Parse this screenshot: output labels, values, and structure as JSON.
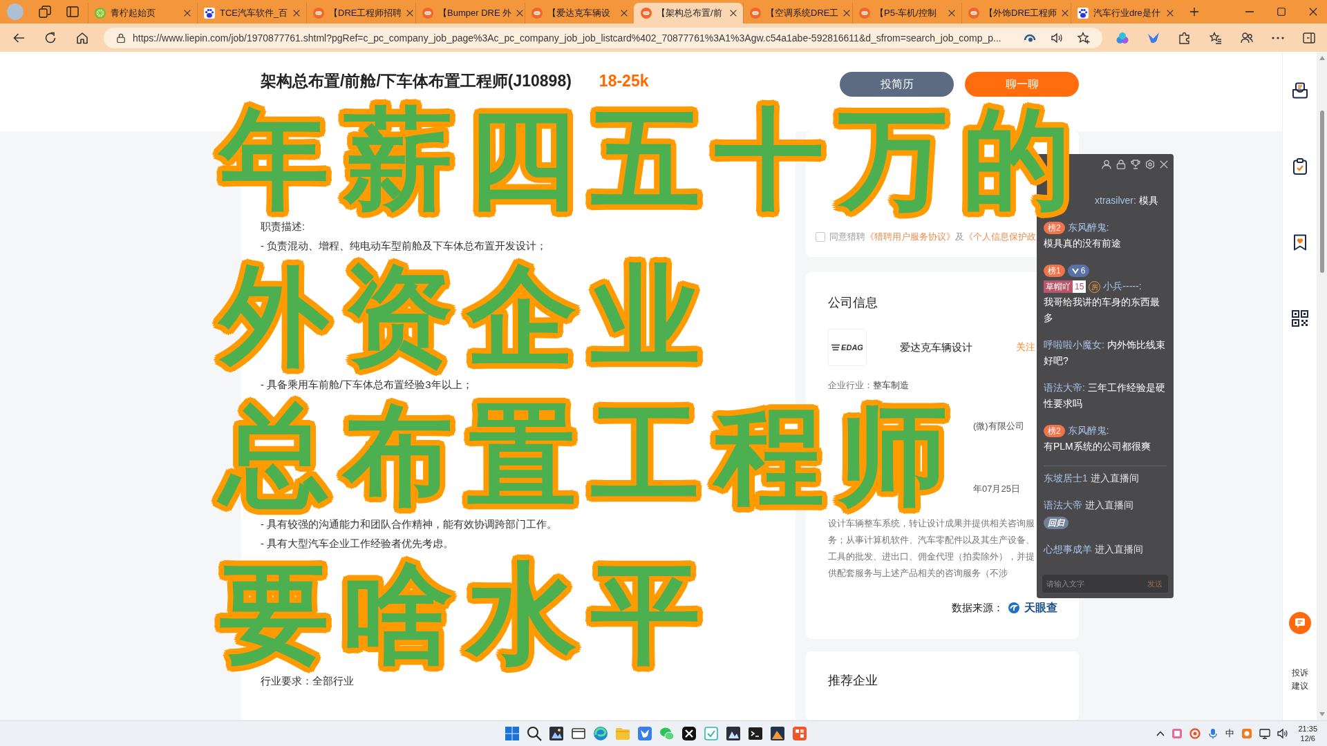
{
  "browser": {
    "tabs": [
      {
        "title": "青柠起始页",
        "kind": "start",
        "selected": false
      },
      {
        "title": "TCE汽车软件_百",
        "kind": "search",
        "selected": false
      },
      {
        "title": "【DRE工程师招聘",
        "kind": "job",
        "selected": false
      },
      {
        "title": "【Bumper DRE 外",
        "kind": "job",
        "selected": false
      },
      {
        "title": "【爱达克车辆设",
        "kind": "job",
        "selected": false
      },
      {
        "title": "【架构总布置/前",
        "kind": "job",
        "selected": true
      },
      {
        "title": "【空调系统DRE工",
        "kind": "job",
        "selected": false
      },
      {
        "title": "【P5-车机/控制",
        "kind": "job",
        "selected": false
      },
      {
        "title": "【外饰DRE工程师",
        "kind": "job",
        "selected": false
      },
      {
        "title": "汽车行业dre是什",
        "kind": "search",
        "selected": false
      }
    ],
    "url": "https://www.liepin.com/job/1970877761.shtml?pgRef=c_pc_company_job_page%3Ac_pc_company_job_job_listcard%402_70877761%3A1%3Agw.c54a1abe-592816611&d_sfrom=search_job_comp_p..."
  },
  "job": {
    "title": "架构总布置/前舱/下车体布置工程师(J10898)",
    "salary": "18-25k",
    "buttons": [
      {
        "label": "投简历",
        "kind": "secondary"
      },
      {
        "label": "聊一聊",
        "kind": "primary"
      }
    ]
  },
  "headline": {
    "lines": [
      "年薪四五十万的",
      "外资企业",
      "总布置工程师",
      "要啥水平"
    ]
  },
  "description": [
    "职责描述:",
    "- 负责混动、增程、纯电动车型前舱及下车体总布置开发设计；",
    "- 具备乘用车前舱/下车体总布置经验3年以上；",
    "- 具有较强的沟通能力和团队合作精神，能有效协调跨部门工作。",
    "- 具有大型汽车企业工作经验者优先考虑。",
    "行业要求：全部行业"
  ],
  "apply_card": {
    "agreed": false,
    "agreement": [
      {
        "kind": "plain",
        "text": "同意猎聘"
      },
      {
        "kind": "link",
        "text": "《猎聘用户服务协议》"
      },
      {
        "kind": "plain",
        "text": "及"
      },
      {
        "kind": "link",
        "text": "《个人信息保护政"
      }
    ]
  },
  "company": {
    "heading": "公司信息",
    "logo_text": "EDAG",
    "name": "爱达克车辆设计",
    "follow": "关注",
    "industry_label": "企业行业：",
    "industry": "整车制造",
    "fragments": [
      "(微)有限公司",
      "年07月25日"
    ],
    "scope": "设计车辆整车系统，转让设计成果并提供相关咨询服务；从事计算机软件、汽车零配件以及其生产设备、工具的批发、进出口、佣金代理（拍卖除外），并提供配套服务与上述产品相关的咨询服务（不涉",
    "source_label": "数据来源：",
    "source_logo": "天眼查"
  },
  "recommend": {
    "heading": "推荐企业"
  },
  "live_chat": {
    "messages": [
      {
        "kind": "chat",
        "user": "xtrasilver:",
        "text": "模具"
      },
      {
        "kind": "chat",
        "badges": [
          {
            "kind": "rank",
            "label": "榜2"
          }
        ],
        "user": "东风醉鬼:",
        "text": "模具真的没有前途"
      },
      {
        "kind": "chat",
        "badges": [
          {
            "kind": "rank",
            "label": "榜1"
          },
          {
            "kind": "level",
            "label": "6"
          },
          {
            "kind": "medal",
            "label": "草帽吖",
            "number": "15"
          },
          {
            "kind": "room",
            "label": "房"
          }
        ],
        "user": "小兵-----:",
        "text": "我哥给我讲的车身的东西最多"
      },
      {
        "kind": "chat",
        "user": "呼啦啦小魔女:",
        "text": "内外饰比线束好吧?"
      },
      {
        "kind": "chat",
        "user": "语法大帝:",
        "text": "三年工作经验是硬性要求吗"
      },
      {
        "kind": "chat",
        "badges": [
          {
            "kind": "rank",
            "label": "榜2"
          }
        ],
        "user": "东风醉鬼:",
        "text": "有PLM系统的公司都很爽"
      },
      {
        "kind": "enter",
        "user": "东坡居士1",
        "text": "进入直播间"
      },
      {
        "kind": "enter",
        "user": "语法大帝",
        "text": "进入直播间",
        "badges": [
          {
            "kind": "return",
            "label": "回归"
          }
        ]
      },
      {
        "kind": "enter",
        "user": "心想事成羊",
        "text": "进入直播间"
      }
    ],
    "input": {
      "placeholder": "请输入文字",
      "send": "发送"
    }
  },
  "sidebar": {
    "feedback": "投诉建议"
  },
  "taskbar": {
    "ime": "中",
    "time": "21:35",
    "date": "12/6"
  }
}
